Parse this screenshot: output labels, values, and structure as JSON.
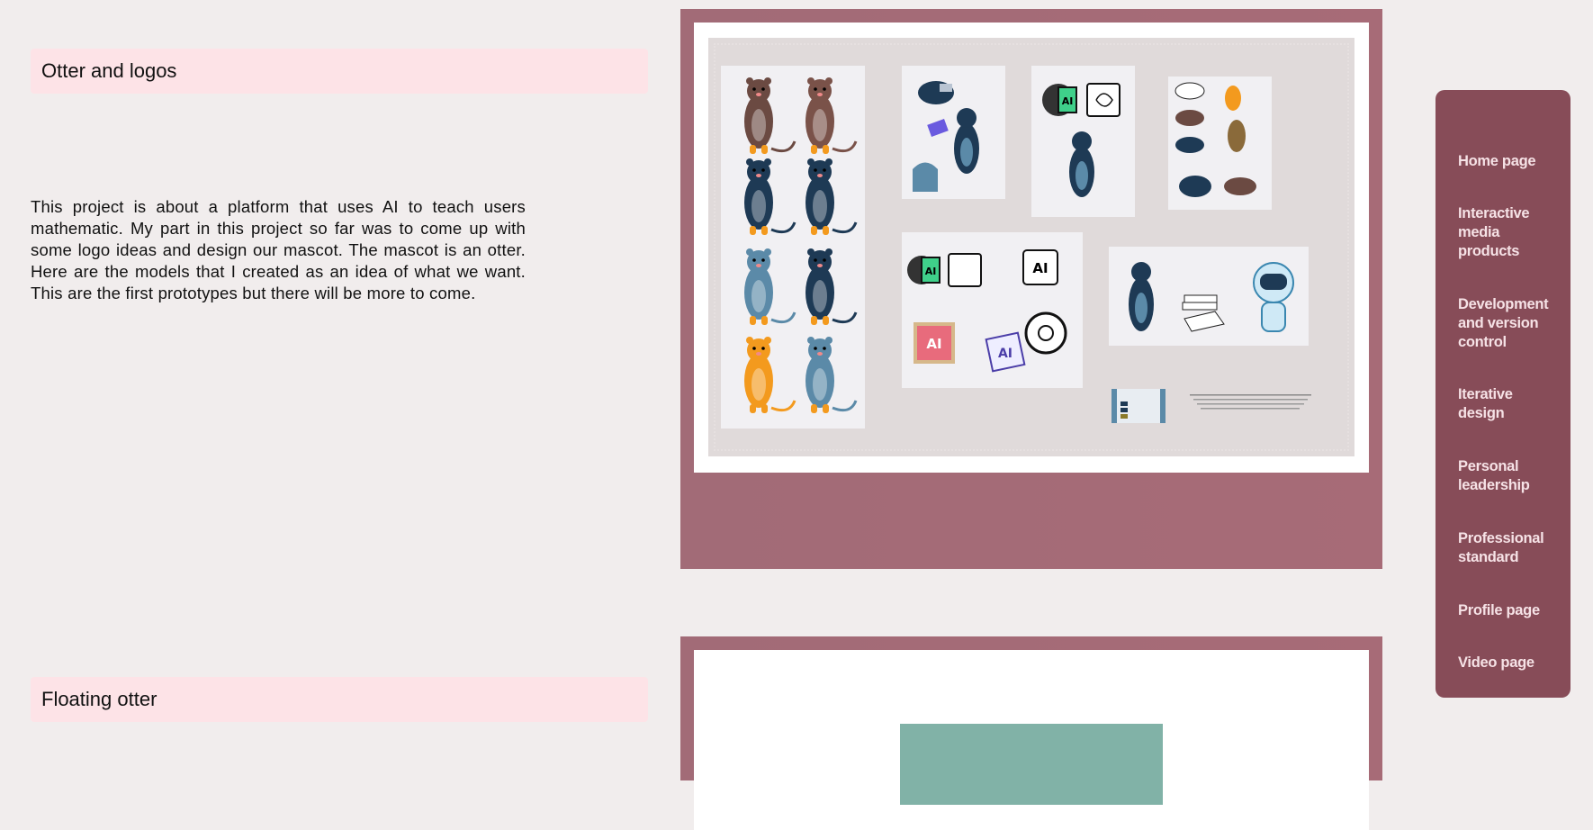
{
  "sections": [
    {
      "title": "Otter and logos",
      "description": "This project is about a platform that uses AI to teach users mathematic. My part in this project so far was to come up with some logo ideas and design our mascot. The mascot is an otter. Here are the models that I created as an idea of what we want. This are the first prototypes but there will be more to come."
    },
    {
      "title": "Floating otter"
    }
  ],
  "nav": {
    "items": [
      {
        "label": "Home page"
      },
      {
        "label": "Interactive media products"
      },
      {
        "label": "Development and version control"
      },
      {
        "label": "Iterative design"
      },
      {
        "label": "Personal leadership"
      },
      {
        "label": "Professional standard"
      },
      {
        "label": "Profile page"
      },
      {
        "label": "Video page"
      }
    ]
  },
  "moodboard": {
    "logo_text": "AI"
  },
  "colors": {
    "page_bg": "#f1eded",
    "heading_bg": "#fde3e7",
    "frame": "#a56b77",
    "nav_bg": "#874c58",
    "nav_text": "#f6e2e6",
    "otter_navy": "#1e3a55",
    "otter_brown": "#6b4a42",
    "otter_blue": "#5b8aa8",
    "otter_orange": "#f39a1e",
    "ai_green": "#3fd08a",
    "teal_block": "#81b2a7"
  }
}
